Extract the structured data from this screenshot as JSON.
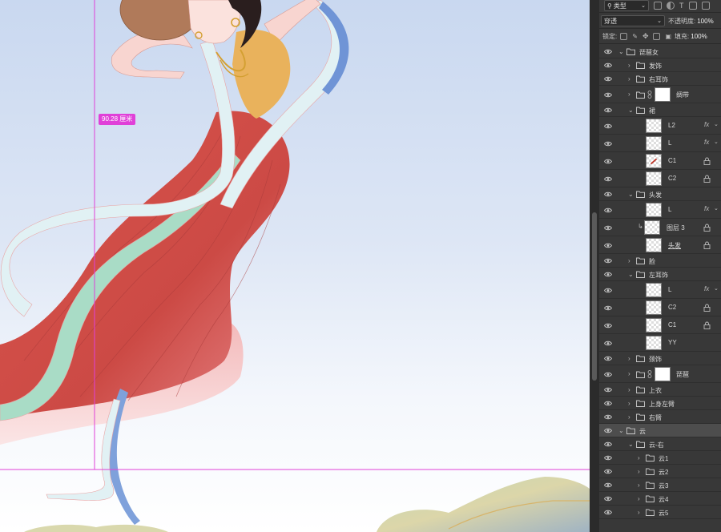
{
  "canvas": {
    "measure_label": "90.28 厘米"
  },
  "panel": {
    "filter_label": "类型",
    "blend_mode": "穿透",
    "opacity_label": "不透明度:",
    "opacity_value": "100%",
    "lock_label": "锁定:",
    "fill_label": "填充:",
    "fill_value": "100%"
  },
  "layers": [
    {
      "name": "琵琶女",
      "kind": "group",
      "open": true,
      "indent": 0
    },
    {
      "name": "发饰",
      "kind": "group",
      "open": false,
      "indent": 1
    },
    {
      "name": "右耳饰",
      "kind": "group",
      "open": false,
      "indent": 1
    },
    {
      "name": "绸带",
      "kind": "group-mask",
      "open": false,
      "indent": 1
    },
    {
      "name": "裙",
      "kind": "group",
      "open": true,
      "indent": 1
    },
    {
      "name": "L2",
      "kind": "layer",
      "indent": 2,
      "fx": true
    },
    {
      "name": "L",
      "kind": "layer",
      "indent": 2,
      "fx": true
    },
    {
      "name": "C1",
      "kind": "layer",
      "indent": 2,
      "lock": true,
      "thumb_mark": true
    },
    {
      "name": "C2",
      "kind": "layer",
      "indent": 2,
      "lock": true
    },
    {
      "name": "头发",
      "kind": "group",
      "open": true,
      "indent": 1
    },
    {
      "name": "L",
      "kind": "layer",
      "indent": 2,
      "fx": true
    },
    {
      "name": "图层 3",
      "kind": "clip-layer",
      "indent": 2,
      "lock": true
    },
    {
      "name": "头发",
      "kind": "layer",
      "indent": 2,
      "lock": true,
      "underline": true
    },
    {
      "name": "脸",
      "kind": "group",
      "open": false,
      "indent": 1
    },
    {
      "name": "左耳饰",
      "kind": "group",
      "open": true,
      "indent": 1
    },
    {
      "name": "L",
      "kind": "layer",
      "indent": 2,
      "fx": true
    },
    {
      "name": "C2",
      "kind": "layer",
      "indent": 2,
      "lock": true
    },
    {
      "name": "C1",
      "kind": "layer",
      "indent": 2,
      "lock": true
    },
    {
      "name": "YY",
      "kind": "layer",
      "indent": 2
    },
    {
      "name": "颈饰",
      "kind": "group",
      "open": false,
      "indent": 1
    },
    {
      "name": "琵琶",
      "kind": "group-mask",
      "open": false,
      "indent": 1
    },
    {
      "name": "上衣",
      "kind": "group",
      "open": false,
      "indent": 1
    },
    {
      "name": "上身左臂",
      "kind": "group",
      "open": false,
      "indent": 1
    },
    {
      "name": "右臂",
      "kind": "group",
      "open": false,
      "indent": 1
    },
    {
      "name": "云",
      "kind": "group",
      "open": true,
      "indent": 0,
      "selected": true
    },
    {
      "name": "云-右",
      "kind": "group",
      "open": true,
      "indent": 1
    },
    {
      "name": "云1",
      "kind": "group",
      "open": false,
      "indent": 2
    },
    {
      "name": "云2",
      "kind": "group",
      "open": false,
      "indent": 2
    },
    {
      "name": "云3",
      "kind": "group",
      "open": false,
      "indent": 2
    },
    {
      "name": "云4",
      "kind": "group",
      "open": false,
      "indent": 2
    },
    {
      "name": "云5",
      "kind": "group",
      "open": false,
      "indent": 2
    }
  ]
}
